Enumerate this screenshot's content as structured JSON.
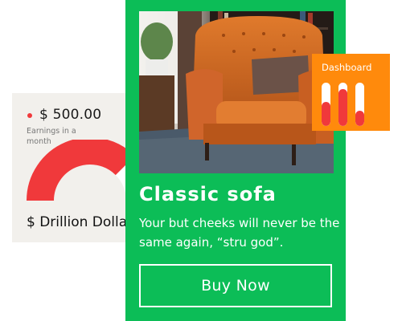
{
  "earnings": {
    "amount": "$ 500.00",
    "subtitle": "Earnings in a month",
    "total": "$ Drillion Dolla",
    "gauge_fraction": 0.75,
    "accent_color": "#f0393b"
  },
  "product": {
    "title": "Classic sofa",
    "description": "Your but cheeks will never be the same again, “stru god”.",
    "buy_label": "Buy Now",
    "card_color": "#0cbd57"
  },
  "dashboard": {
    "title": "Dashboard",
    "bars": [
      0.55,
      0.85,
      0.35
    ],
    "widget_color": "#ff8a0c"
  }
}
